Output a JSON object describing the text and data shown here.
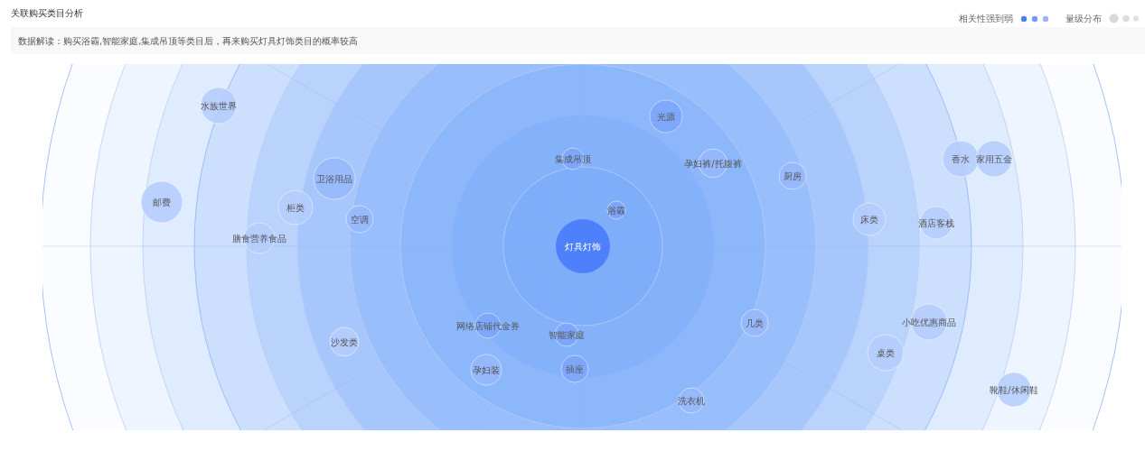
{
  "title": "关联购买类目分析",
  "legend": {
    "relevance_label": "相关性强到弱",
    "magnitude_label": "量级分布"
  },
  "note": "数据解读：购买浴霸,智能家庭,集成吊顶等类目后，再来购买灯具灯饰类目的概率较高",
  "chart": {
    "center": "灯具灯饰",
    "categories": [
      {
        "label": "集成吊顶"
      },
      {
        "label": "浴霸"
      },
      {
        "label": "光源"
      },
      {
        "label": "孕妇裤/托腹裤"
      },
      {
        "label": "厨房"
      },
      {
        "label": "床类"
      },
      {
        "label": "酒店客栈"
      },
      {
        "label": "香水"
      },
      {
        "label": "家用五金"
      },
      {
        "label": "水族世界"
      },
      {
        "label": "卫浴用品"
      },
      {
        "label": "邮费"
      },
      {
        "label": "柜类"
      },
      {
        "label": "空调"
      },
      {
        "label": "膳食营养食品"
      },
      {
        "label": "沙发类"
      },
      {
        "label": "网络店铺代金券"
      },
      {
        "label": "智能家庭"
      },
      {
        "label": "孕妇装"
      },
      {
        "label": "插座"
      },
      {
        "label": "几类"
      },
      {
        "label": "洗衣机"
      },
      {
        "label": "桌类"
      },
      {
        "label": "小吃优惠商品"
      },
      {
        "label": "靴鞋/休闲鞋"
      }
    ]
  }
}
